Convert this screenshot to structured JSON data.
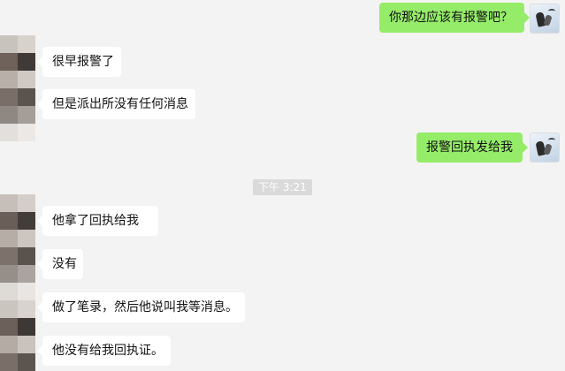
{
  "window": {
    "title": ""
  },
  "time_divider": "下午 3:21",
  "messages": {
    "m1": "你那边应该有报警吧？",
    "m2": "很早报警了",
    "m3": "但是派出所没有任何消息",
    "m4": "报警回执发给我",
    "m5": "他拿了回执给我",
    "m6": "没有",
    "m7": "做了笔录，然后他说叫我等消息。",
    "m8": "他没有给我回执证。"
  },
  "colors": {
    "background": "#f3f3f3",
    "incoming_bubble": "#ffffff",
    "outgoing_bubble": "#95ec69",
    "timestamp_bg": "#dadada"
  }
}
